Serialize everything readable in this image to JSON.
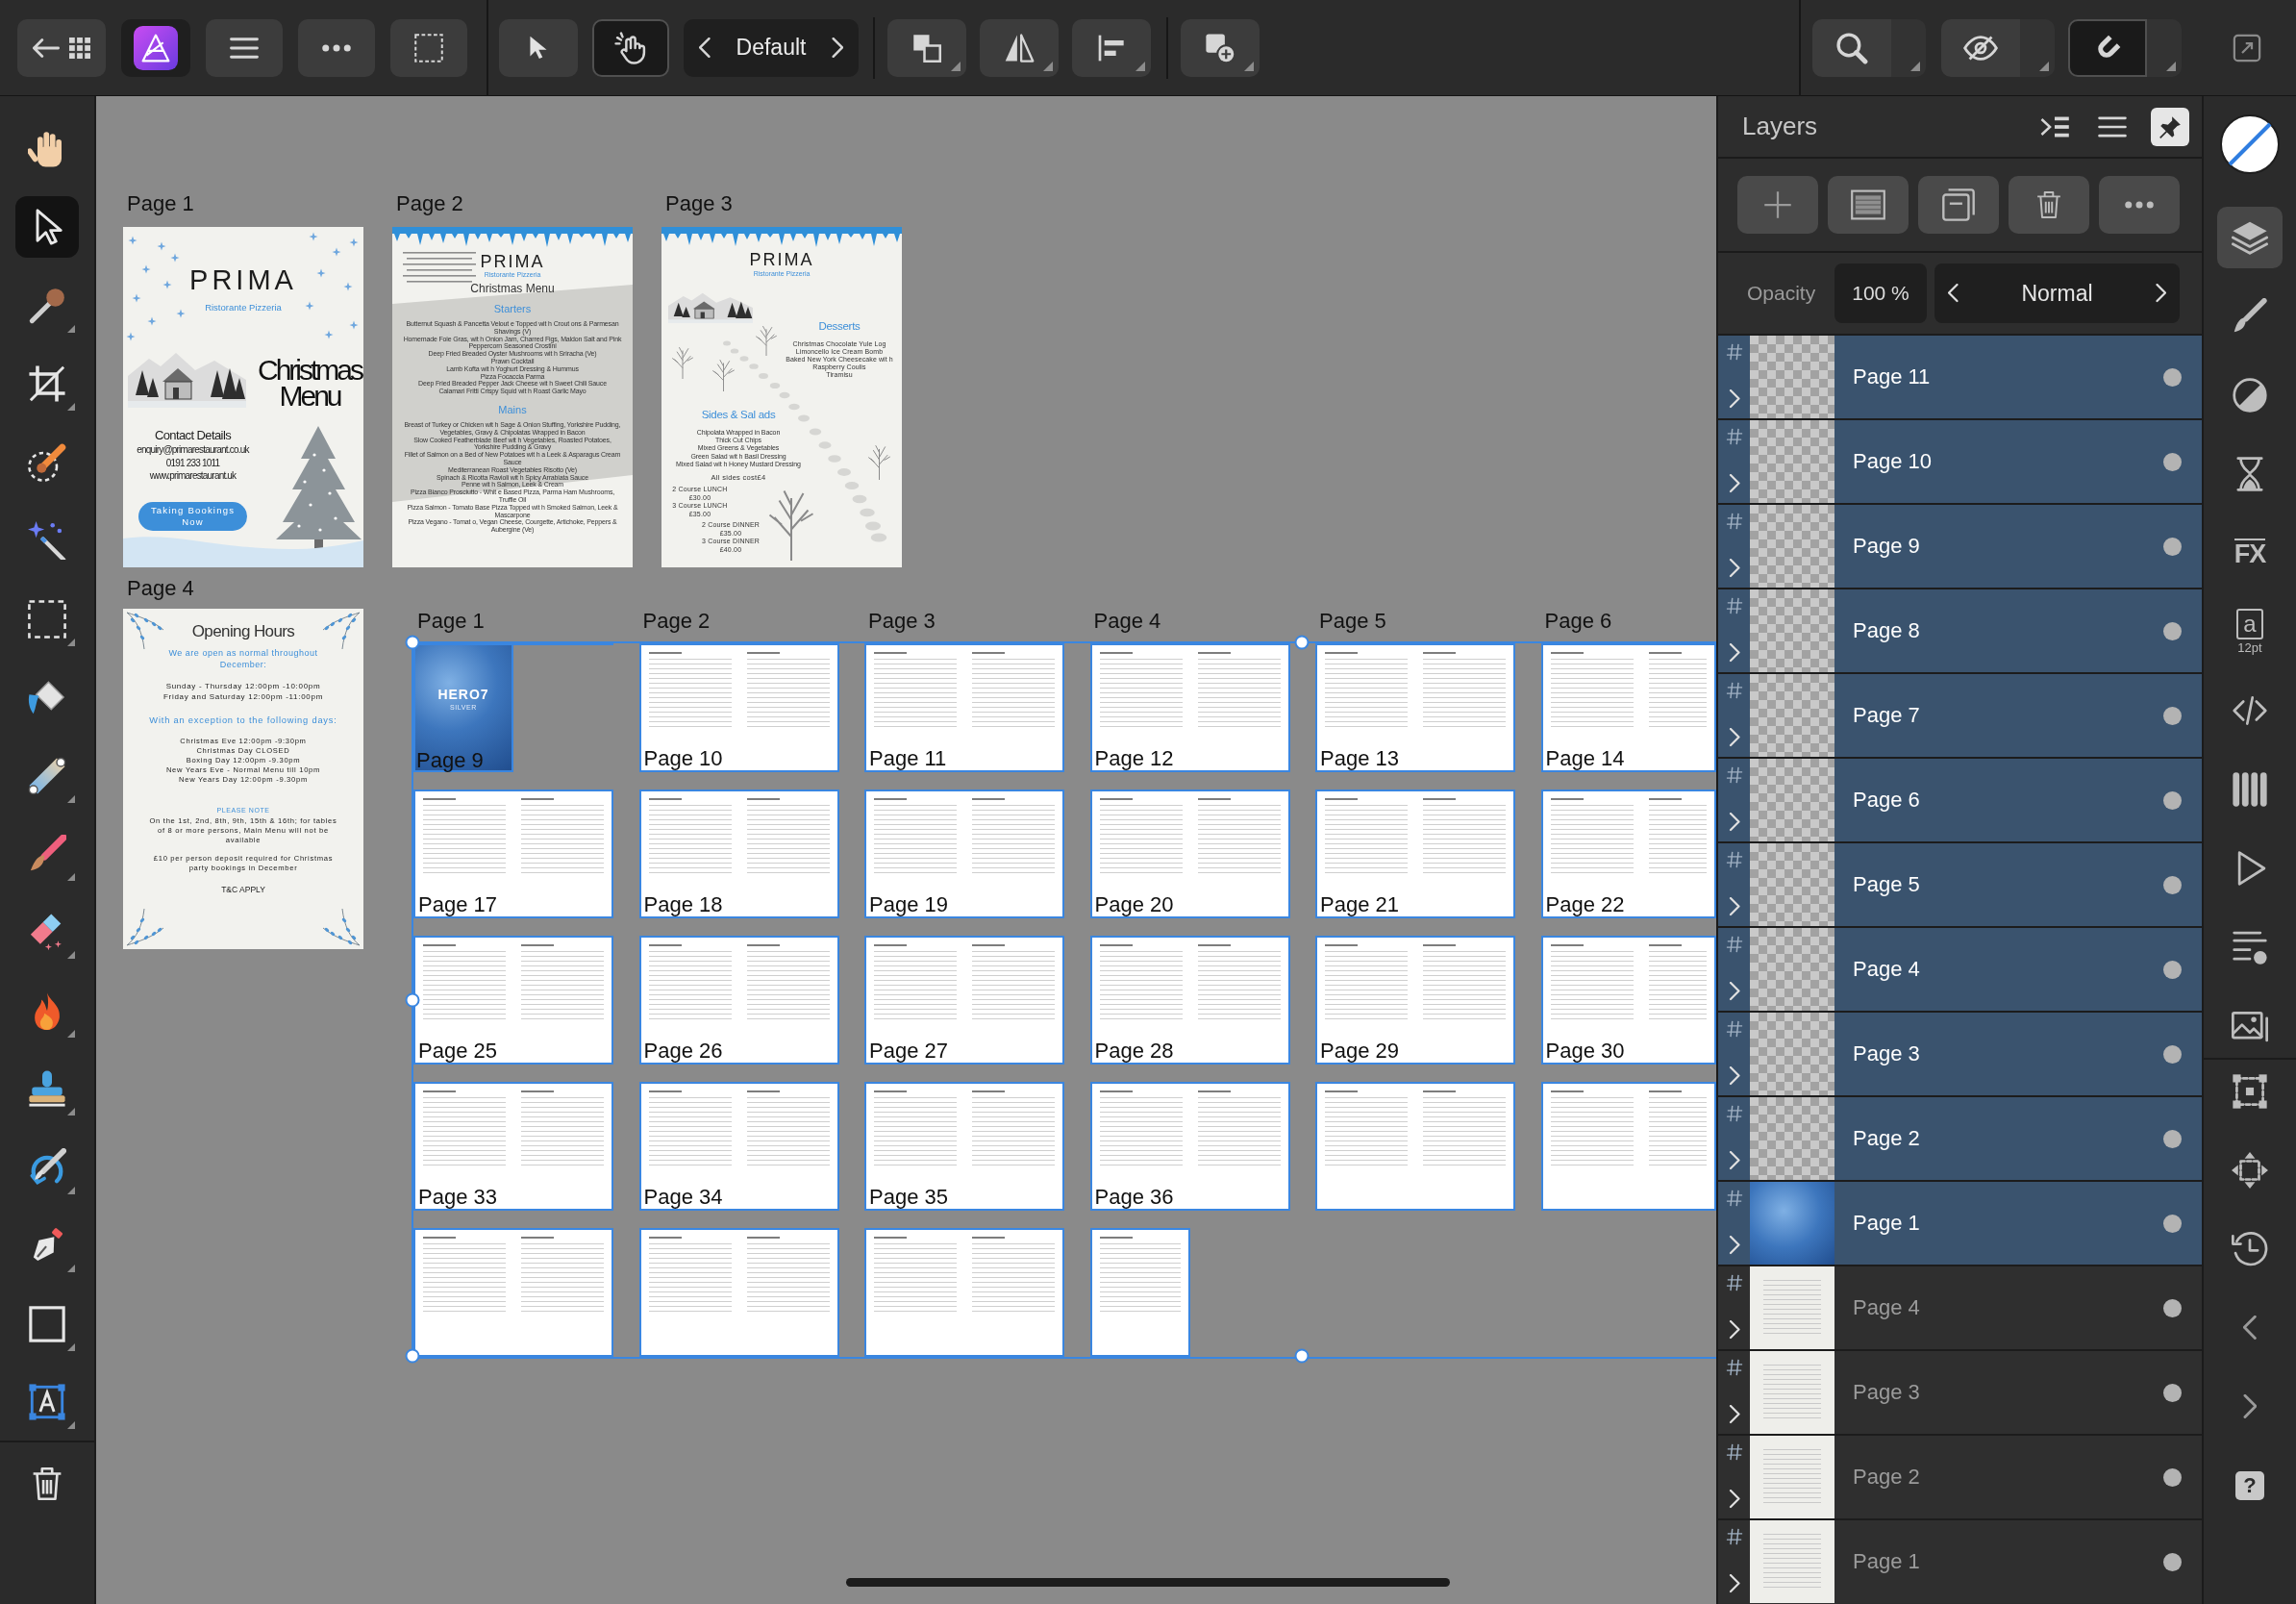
{
  "toolbar": {
    "preset": "Default",
    "touch_on": true,
    "snapping_on": true
  },
  "tools": [
    {
      "selected": false
    },
    {
      "selected": true
    },
    {
      "selected": false
    },
    {
      "selected": false
    },
    {
      "selected": false
    },
    {
      "selected": false
    },
    {
      "selected": false
    },
    {
      "selected": false
    },
    {
      "selected": false
    },
    {
      "selected": false
    },
    {
      "selected": false
    },
    {
      "selected": false
    },
    {
      "selected": false
    },
    {
      "selected": false
    },
    {
      "selected": false
    },
    {
      "selected": false
    },
    {
      "selected": false
    }
  ],
  "artboard_rows": [
    [
      {
        "kind": "cover",
        "label": "Page 1",
        "title": "PRIMA",
        "subtitle": "Ristorante Pizzeria",
        "heading": "Christmas Menu",
        "contact_heading": "Contact Details",
        "contact_lines": [
          "enquiry@primarestaurant.co.uk",
          "0191 233 1011",
          "www.primarestaurant.uk"
        ],
        "button": "Taking Bookings Now"
      },
      {
        "kind": "menu",
        "label": "Page 2",
        "title": "PRIMA",
        "subtitle": "Ristorante Pizzeria",
        "heading": "Christmas Menu",
        "sections": [
          {
            "title": "Starters",
            "items": [
              "Butternut Squash & Pancetta Velout e Topped wit h Crout ons & Parmesan Shavings (V)",
              "Homemade Foie Gras, wit h Onion Jam, Charred Figs, Maldon Salt and Pink Peppercorn Seasoned Crostini",
              "Deep Fried Breaded Oyster Mushrooms wit h Sriracha (Ve)",
              "Prawn Cocktail",
              "Lamb Kofta wit h Yoghurt Dressing & Hummus",
              "Pizza Focaccia Parma",
              "Deep Fried Breaded Pepper Jack Cheese wit h Sweet Chili Sauce",
              "Calamari Fritti Crispy Squid wit h Roast Garlic Mayo"
            ]
          },
          {
            "title": "Mains",
            "items": [
              "Breast of Turkey or Chicken wit h Sage & Onion Stuffing, Yorkshire Pudding, Vegetables, Gravy & Chipolatas Wrapped in Bacon",
              "Slow Cooked Featherblade Beef wit h Vegetables, Roasted Potatoes, Yorkshire Pudding & Gravy",
              "Fillet of Salmon on a Bed of New Potatoes wit h a Leek & Asparagus Cream Sauce",
              "Mediterranean Roast Vegetables Risotto (Ve)",
              "Spinach & Ricotta Ravioli wit h Spicy Arrabiata Sauce",
              "Penne wit h Salmon, Leek & Cream",
              "Pizza Bianco Prosciutto - Whit e Based Pizza, Parma Ham Mushrooms, Truffle Oil",
              "Pizza Salmon - Tomato Base Pizza Topped wit h Smoked Salmon, Leek & Mascarpone",
              "Pizza Vegano - Tomat o, Vegan Cheese, Courgette, Artichoke, Peppers & Aubergine (Ve)"
            ]
          }
        ]
      },
      {
        "kind": "desserts",
        "label": "Page 3",
        "title": "PRIMA",
        "subtitle": "Ristorante Pizzeria",
        "sections": [
          {
            "title": "Desserts",
            "items": [
              "Christmas Chocolate Yule Log",
              "Limoncello Ice Cream Bomb",
              "Baked New York Cheesecake wit h Raspberry Coulis",
              "Tiramisu"
            ]
          },
          {
            "title": "Sides & Sal ads",
            "items": [
              "Chipolata Wrapped in Bacon",
              "Thick Cut Chips",
              "Mixed Greens & Vegetables",
              "Green Salad wit h Basil Dressing",
              "Mixed Salad wit h Honey Mustard Dressing"
            ]
          }
        ],
        "note": "All sides cost£4",
        "price_blocks": [
          [
            "2 Course LUNCH",
            "£30.00",
            "3 Course LUNCH",
            "£35.00"
          ],
          [
            "2 Course DINNER",
            "£35.00",
            "3 Course DINNER",
            "£40.00"
          ]
        ]
      }
    ],
    [
      {
        "kind": "hours",
        "label": "Page 4",
        "title": "Opening Hours",
        "intro": "We are open as normal throughout December:",
        "hours": [
          "Sunday - Thursday 12:00pm -10:00pm",
          "Friday and Saturday 12:00pm -11:00pm"
        ],
        "exception_heading": "With an exception to the following days:",
        "exceptions": [
          "Christmas Eve 12:00pm -9:30pm",
          "Christmas Day CLOSED",
          "Boxing Day 12:00pm -9.30pm",
          "New Years Eve - Normal Menu till 10pm",
          "New Years Day 12:00pm -9.30pm"
        ],
        "note_heading": "PLEASE NOTE",
        "notes": [
          "On the 1st, 2nd, 8th, 9th, 15th & 16th; for tables of 8 or more persons, Main Menu will not be available",
          "£10 per person deposit required for Christmas party bookings in December"
        ],
        "footer": "T&C APPLY"
      }
    ]
  ],
  "document": {
    "column_labels": [
      "Page 1",
      "Page 2",
      "Page 3",
      "Page 4",
      "Page 5",
      "Page 6"
    ],
    "spread_rows": [
      [
        {
          "kind": "cover",
          "label": "Page 9",
          "title": "HERO7",
          "subtitle": "SILVER"
        },
        {
          "kind": "pair",
          "label": "Page 10"
        },
        {
          "kind": "pair",
          "label": "Page 11"
        },
        {
          "kind": "pair",
          "label": "Page 12"
        },
        {
          "kind": "pair",
          "label": "Page 13"
        },
        {
          "kind": "pair",
          "label": "Page 14"
        }
      ],
      [
        {
          "kind": "pair",
          "label": "Page 17"
        },
        {
          "kind": "pair",
          "label": "Page 18"
        },
        {
          "kind": "pair",
          "label": "Page 19"
        },
        {
          "kind": "pair",
          "label": "Page 20"
        },
        {
          "kind": "pair",
          "label": "Page 21"
        },
        {
          "kind": "pair",
          "label": "Page 22"
        }
      ],
      [
        {
          "kind": "pair",
          "label": "Page 25"
        },
        {
          "kind": "pair",
          "label": "Page 26"
        },
        {
          "kind": "pair",
          "label": "Page 27"
        },
        {
          "kind": "pair",
          "label": "Page 28"
        },
        {
          "kind": "pair",
          "label": "Page 29"
        },
        {
          "kind": "pair",
          "label": "Page 30"
        }
      ],
      [
        {
          "kind": "pair",
          "label": "Page 33"
        },
        {
          "kind": "pair",
          "label": "Page 34"
        },
        {
          "kind": "pair",
          "label": "Page 35"
        },
        {
          "kind": "pair",
          "label": "Page 36"
        },
        {
          "kind": "pair"
        },
        {
          "kind": "pair"
        }
      ],
      [
        {
          "kind": "pair"
        },
        {
          "kind": "pair"
        },
        {
          "kind": "pair"
        },
        {
          "kind": "single"
        }
      ]
    ]
  },
  "layers_panel": {
    "title": "Layers",
    "pinned": true,
    "opacity_label": "Opacity",
    "opacity_value": "100 %",
    "blend_mode": "Normal",
    "layers": [
      {
        "name": "Page 11",
        "selected": true,
        "kind": "checker"
      },
      {
        "name": "Page 10",
        "selected": true,
        "kind": "checker"
      },
      {
        "name": "Page 9",
        "selected": true,
        "kind": "checker"
      },
      {
        "name": "Page 8",
        "selected": true,
        "kind": "checker"
      },
      {
        "name": "Page 7",
        "selected": true,
        "kind": "checker"
      },
      {
        "name": "Page 6",
        "selected": true,
        "kind": "checker"
      },
      {
        "name": "Page 5",
        "selected": true,
        "kind": "checker"
      },
      {
        "name": "Page 4",
        "selected": true,
        "kind": "checker"
      },
      {
        "name": "Page 3",
        "selected": true,
        "kind": "checker"
      },
      {
        "name": "Page 2",
        "selected": true,
        "kind": "checker"
      },
      {
        "name": "Page 1",
        "selected": true,
        "kind": "cover"
      },
      {
        "name": "Page 4",
        "selected": false,
        "kind": "page"
      },
      {
        "name": "Page 3",
        "selected": false,
        "kind": "page"
      },
      {
        "name": "Page 2",
        "selected": false,
        "kind": "page"
      },
      {
        "name": "Page 1",
        "selected": false,
        "kind": "page"
      }
    ]
  },
  "studio_tabs": [
    {
      "selected": true
    },
    {
      "selected": false
    },
    {
      "selected": false
    },
    {
      "selected": false
    },
    {
      "selected": false,
      "glyph": "FX"
    },
    {
      "selected": false,
      "glyph": "a",
      "caption": "12pt"
    },
    {
      "selected": false
    },
    {
      "selected": false
    },
    {
      "selected": false
    },
    {
      "selected": false
    },
    {
      "selected": false
    }
  ],
  "studio_tools": [
    {
      "selected": false
    },
    {
      "selected": false
    },
    {
      "selected": false
    }
  ],
  "help": "?"
}
